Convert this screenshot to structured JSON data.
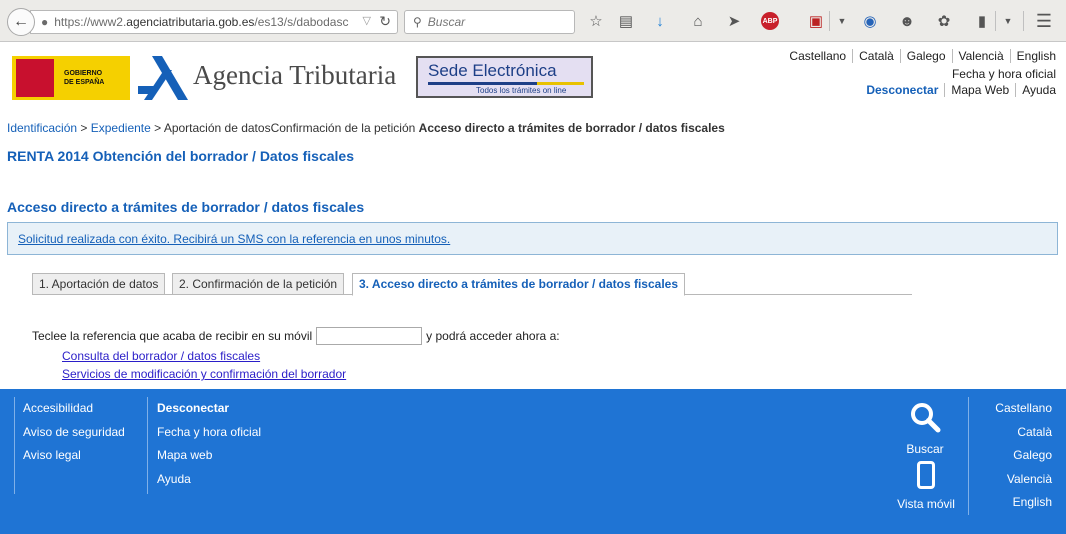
{
  "browser": {
    "url_prefix": "https://www2.",
    "url_domain": "agenciatributaria.gob.es",
    "url_path": "/es13/s/dabodasc",
    "search_placeholder": "Buscar"
  },
  "header": {
    "gov_logo_line1": "GOBIERNO",
    "gov_logo_line2": "DE ESPAÑA",
    "agency_name": "Agencia Tributaria",
    "sede_title": "Sede Electrónica",
    "sede_subtitle": "Todos los trámites on line",
    "languages": [
      "Castellano",
      "Català",
      "Galego",
      "Valencià",
      "English"
    ],
    "fecha_hora": "Fecha y hora oficial",
    "desconectar": "Desconectar",
    "mapa_web": "Mapa Web",
    "ayuda": "Ayuda"
  },
  "breadcrumb": {
    "items": [
      "Identificación",
      "Expediente"
    ],
    "separator": ">",
    "plain": "Aportación de datosConfirmación de la petición",
    "current": "Acceso directo a trámites de borrador / datos fiscales"
  },
  "page_title": "RENTA 2014 Obtención del borrador / Datos fiscales",
  "section_title": "Acceso directo a trámites de borrador / datos fiscales",
  "message": "Solicitud realizada con éxito. Recibirá un SMS con la referencia en unos minutos.",
  "tabs": [
    {
      "label": "1. Aportación de datos",
      "active": false
    },
    {
      "label": "2. Confirmación de la petición",
      "active": false
    },
    {
      "label": "3. Acceso directo a trámites de borrador / datos fiscales",
      "active": true
    }
  ],
  "reference": {
    "label_before": "Teclee la referencia que acaba de recibir en su móvil",
    "label_after": "y podrá acceder ahora a:",
    "value": ""
  },
  "links": [
    "Consulta del borrador / datos fiscales",
    "Servicios de modificación y confirmación del borrador"
  ],
  "footer": {
    "col1": [
      "Accesibilidad",
      "Aviso de seguridad",
      "Aviso legal"
    ],
    "col2": [
      "Desconectar",
      "Fecha y hora oficial",
      "Mapa web",
      "Ayuda"
    ],
    "search_label": "Buscar",
    "mobile_label": "Vista móvil",
    "languages": [
      "Castellano",
      "Català",
      "Galego",
      "Valencià",
      "English"
    ]
  },
  "colors": {
    "accent": "#1560b8",
    "footer_bg": "#1f74d4",
    "message_bg": "#e8f1f8"
  }
}
